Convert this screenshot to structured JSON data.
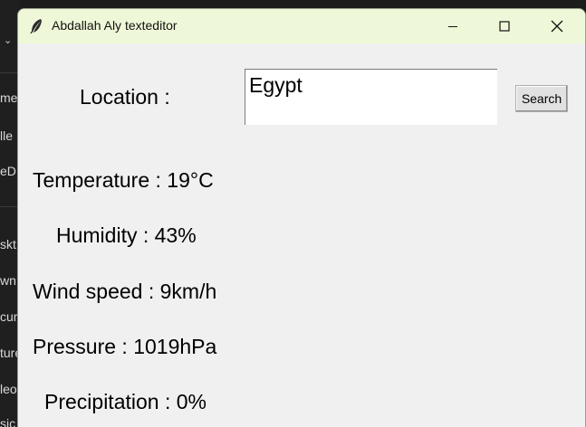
{
  "background": {
    "items": [
      "me",
      "lle",
      "eD",
      "skt",
      "wn",
      "cur",
      "ture",
      "leo",
      "sic"
    ]
  },
  "window": {
    "title": "Abdallah Aly texteditor",
    "icon": "feather-icon",
    "controls": {
      "minimize": "minimize-icon",
      "maximize": "maximize-icon",
      "close": "close-icon"
    }
  },
  "form": {
    "location_label": "Location :",
    "location_value": "Egypt",
    "search_label": "Search"
  },
  "weather": {
    "temperature": "Temperature : 19°C",
    "humidity": "Humidity : 43%",
    "wind_speed": "Wind speed : 9km/h",
    "pressure": "Pressure : 1019hPa",
    "precipitation": "Precipitation : 0%"
  },
  "colors": {
    "titlebar": "#eef8d8",
    "window_bg": "#f0f0f0",
    "desktop_bg": "#1f1f1f"
  }
}
